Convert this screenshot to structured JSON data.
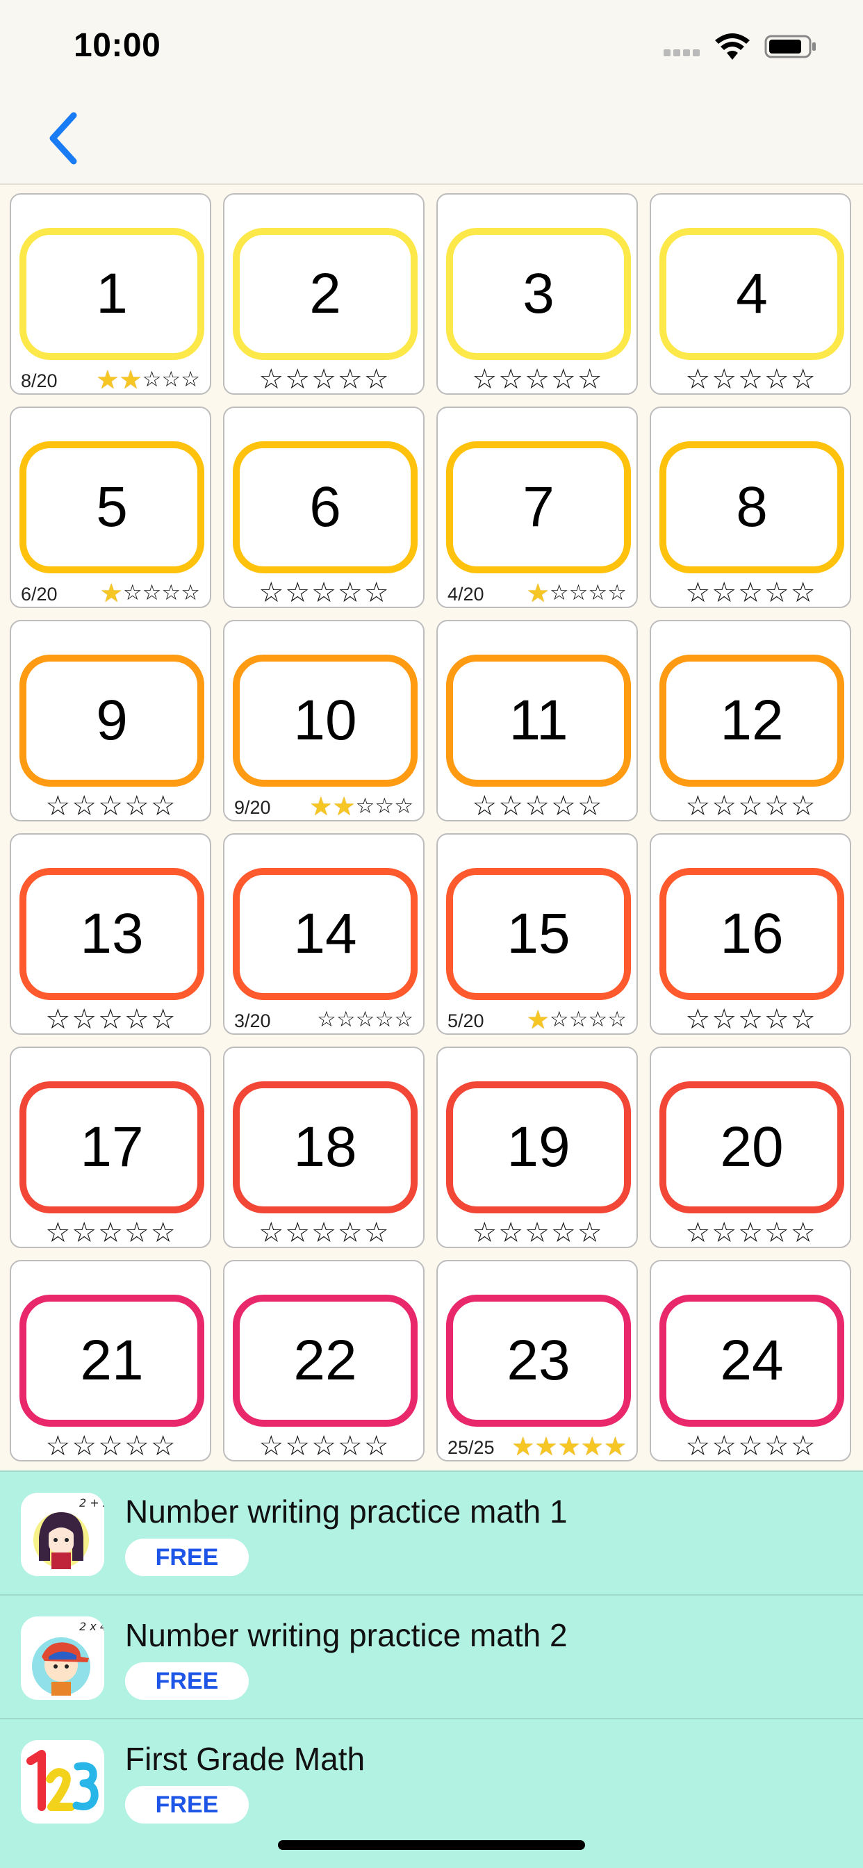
{
  "status_bar": {
    "time": "10:00"
  },
  "nav": {
    "back_icon": "chevron-left-icon",
    "accent": "#1a7cf5"
  },
  "levels": [
    {
      "number": "1",
      "color": "#fde84a",
      "progress": "8/20",
      "stars_earned": 2
    },
    {
      "number": "2",
      "color": "#fde84a",
      "progress": "",
      "stars_earned": 0
    },
    {
      "number": "3",
      "color": "#fde84a",
      "progress": "",
      "stars_earned": 0
    },
    {
      "number": "4",
      "color": "#fde84a",
      "progress": "",
      "stars_earned": 0
    },
    {
      "number": "5",
      "color": "#ffc20c",
      "progress": "6/20",
      "stars_earned": 1
    },
    {
      "number": "6",
      "color": "#ffc20c",
      "progress": "",
      "stars_earned": 0
    },
    {
      "number": "7",
      "color": "#ffc20c",
      "progress": "4/20",
      "stars_earned": 1
    },
    {
      "number": "8",
      "color": "#ffc20c",
      "progress": "",
      "stars_earned": 0
    },
    {
      "number": "9",
      "color": "#ff9b12",
      "progress": "",
      "stars_earned": 0
    },
    {
      "number": "10",
      "color": "#ff9b12",
      "progress": "9/20",
      "stars_earned": 2
    },
    {
      "number": "11",
      "color": "#ff9b12",
      "progress": "",
      "stars_earned": 0
    },
    {
      "number": "12",
      "color": "#ff9b12",
      "progress": "",
      "stars_earned": 0
    },
    {
      "number": "13",
      "color": "#ff5a2e",
      "progress": "",
      "stars_earned": 0
    },
    {
      "number": "14",
      "color": "#ff5a2e",
      "progress": "3/20",
      "stars_earned": 0
    },
    {
      "number": "15",
      "color": "#ff5a2e",
      "progress": "5/20",
      "stars_earned": 1
    },
    {
      "number": "16",
      "color": "#ff5a2e",
      "progress": "",
      "stars_earned": 0
    },
    {
      "number": "17",
      "color": "#f24636",
      "progress": "",
      "stars_earned": 0
    },
    {
      "number": "18",
      "color": "#f24636",
      "progress": "",
      "stars_earned": 0
    },
    {
      "number": "19",
      "color": "#f24636",
      "progress": "",
      "stars_earned": 0
    },
    {
      "number": "20",
      "color": "#f24636",
      "progress": "",
      "stars_earned": 0
    },
    {
      "number": "21",
      "color": "#e8286a",
      "progress": "",
      "stars_earned": 0
    },
    {
      "number": "22",
      "color": "#e8286a",
      "progress": "",
      "stars_earned": 0
    },
    {
      "number": "23",
      "color": "#e8286a",
      "progress": "25/25",
      "stars_earned": 5
    },
    {
      "number": "24",
      "color": "#e8286a",
      "progress": "",
      "stars_earned": 0
    }
  ],
  "stars_total": 5,
  "ads": [
    {
      "title": "Number writing practice math 1",
      "badge": "FREE",
      "icon": "girl-app-icon"
    },
    {
      "title": "Number writing practice math 2",
      "badge": "FREE",
      "icon": "boy-app-icon"
    },
    {
      "title": "First Grade Math",
      "badge": "FREE",
      "icon": "numbers-123-app-icon"
    }
  ]
}
